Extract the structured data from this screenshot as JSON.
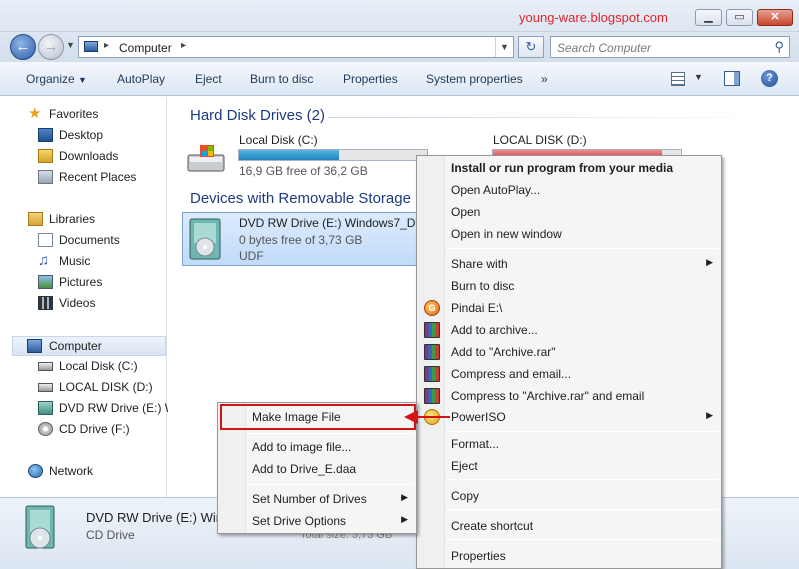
{
  "watermark": "young-ware.blogspot.com",
  "window_controls": {
    "minimize": "▁",
    "maximize": "▭",
    "close": "✕"
  },
  "address": {
    "crumb": "Computer",
    "separator": "▸"
  },
  "search": {
    "placeholder": "Search Computer"
  },
  "toolbar": {
    "organize": "Organize",
    "autoplay": "AutoPlay",
    "eject": "Eject",
    "burn": "Burn to disc",
    "properties": "Properties",
    "system_properties": "System properties",
    "more": "»"
  },
  "nav": {
    "favorites": "Favorites",
    "desktop": "Desktop",
    "downloads": "Downloads",
    "recent": "Recent Places",
    "libraries": "Libraries",
    "documents": "Documents",
    "music": "Music",
    "pictures": "Pictures",
    "videos": "Videos",
    "computer": "Computer",
    "local_c": "Local Disk (C:)",
    "local_d": "LOCAL DISK (D:)",
    "dvd_e": "DVD RW Drive (E:) W",
    "cd_f": "CD Drive (F:)",
    "network": "Network"
  },
  "groups": {
    "hdd": "Hard Disk Drives (2)",
    "removable": "Devices with Removable Storage ("
  },
  "drives": {
    "c": {
      "name": "Local Disk (C:)",
      "free": "16,9 GB free of 36,2 GB",
      "used_fraction": 0.53
    },
    "d": {
      "name": "LOCAL DISK (D:)",
      "used_fraction": 0.9
    },
    "e": {
      "name": "DVD RW Drive (E:) Windows7_DVD",
      "free": "0 bytes free of 3,73 GB",
      "fs": "UDF"
    }
  },
  "details": {
    "name": "DVD RW Drive (E:) Win",
    "type": "CD Drive",
    "total": "Total size: 3,73 GB"
  },
  "context_menu": {
    "items": [
      {
        "label": "Install or run program from your media",
        "bold": true
      },
      {
        "label": "Open AutoPlay..."
      },
      {
        "label": "Open"
      },
      {
        "label": "Open in new window"
      },
      {
        "label": "Share with",
        "submenu": true
      },
      {
        "label": "Burn to disc"
      },
      {
        "label": "Pindai E:\\",
        "icon": "pindai-icon"
      },
      {
        "label": "Add to archive...",
        "icon": "winrar-icon"
      },
      {
        "label": "Add to \"Archive.rar\"",
        "icon": "winrar-icon"
      },
      {
        "label": "Compress and email...",
        "icon": "winrar-icon"
      },
      {
        "label": "Compress to \"Archive.rar\" and email",
        "icon": "winrar-icon"
      },
      {
        "label": "PowerISO",
        "icon": "poweriso-icon",
        "submenu": true
      },
      {
        "label": "Format..."
      },
      {
        "label": "Eject"
      },
      {
        "label": "Copy"
      },
      {
        "label": "Create shortcut"
      },
      {
        "label": "Properties"
      }
    ]
  },
  "poweriso_submenu": {
    "items": [
      {
        "label": "Make Image File",
        "highlighted": true
      },
      {
        "label": "Add to image file..."
      },
      {
        "label": "Add to Drive_E.daa"
      },
      {
        "label": "Set Number of Drives",
        "submenu": true
      },
      {
        "label": "Set Drive Options",
        "submenu": true
      }
    ]
  },
  "colors": {
    "highlight_red": "#d41313",
    "accent_blue": "#1e3a80"
  }
}
